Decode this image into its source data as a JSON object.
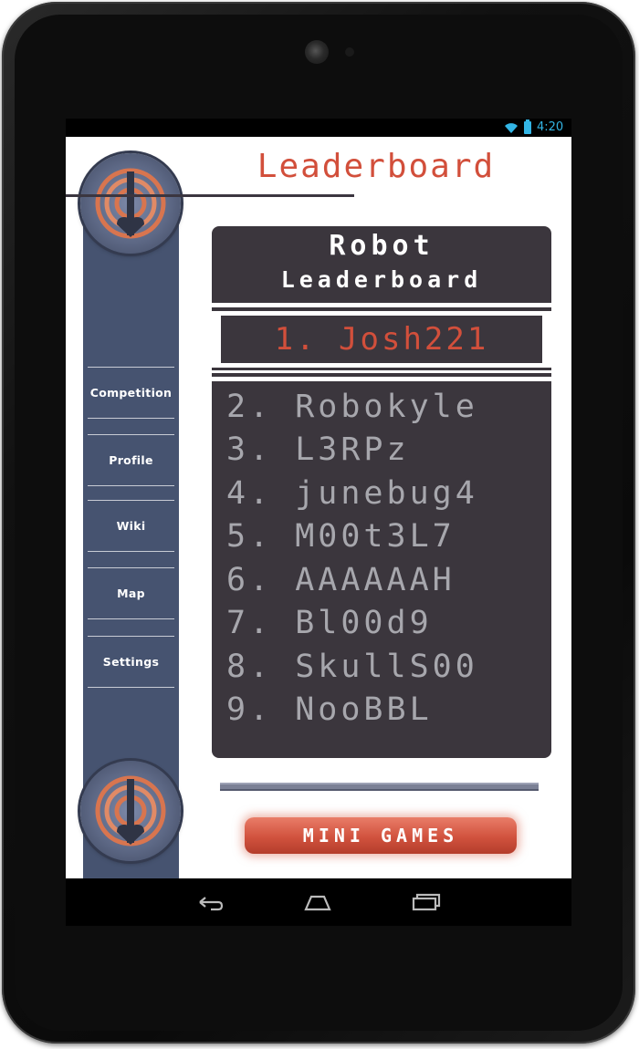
{
  "status_bar": {
    "time": "4:20",
    "wifi_icon": "wifi-icon",
    "battery_icon": "battery-icon"
  },
  "page": {
    "title": "Leaderboard"
  },
  "sidebar": {
    "items": [
      {
        "label": "Competition"
      },
      {
        "label": "Profile"
      },
      {
        "label": "Wiki"
      },
      {
        "label": "Map"
      },
      {
        "label": "Settings"
      }
    ]
  },
  "leaderboard": {
    "title_line1": "Robot",
    "title_line2": "Leaderboard",
    "first": "1. Josh221",
    "entries": [
      "2. Robokyle",
      "3. L3RPz",
      "4. junebug4",
      "5. M00t3L7",
      "6. AAAAAAH",
      "7. Bl00d9",
      "8. SkullS00",
      "9. NooBBL"
    ]
  },
  "mini_games_button": {
    "label": "MINI GAMES"
  },
  "colors": {
    "accent": "#d24f3b",
    "panel": "#3b363d",
    "sidebar": "#465370"
  },
  "system_nav": {
    "back_icon": "back-icon",
    "home_icon": "home-icon",
    "recents_icon": "recents-icon"
  }
}
